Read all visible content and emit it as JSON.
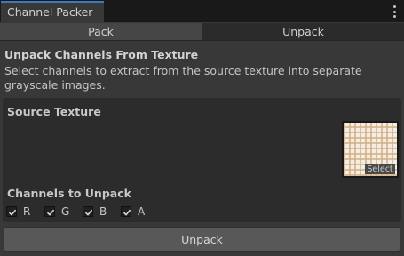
{
  "window": {
    "tab_title": "Channel Packer",
    "menu_icon": "more-vertical-icon"
  },
  "mode_tabs": [
    {
      "label": "Pack",
      "selected": false
    },
    {
      "label": "Unpack",
      "selected": true
    }
  ],
  "section": {
    "heading": "Unpack Channels From Texture",
    "description": "Select channels to extract from the source texture into separate grayscale images."
  },
  "source_texture": {
    "label": "Source Texture",
    "select_label": "Select"
  },
  "channels": {
    "label": "Channels to Unpack",
    "items": [
      {
        "label": "R",
        "checked": true
      },
      {
        "label": "G",
        "checked": true
      },
      {
        "label": "B",
        "checked": true
      },
      {
        "label": "A",
        "checked": true
      }
    ]
  },
  "actions": {
    "unpack_label": "Unpack"
  }
}
